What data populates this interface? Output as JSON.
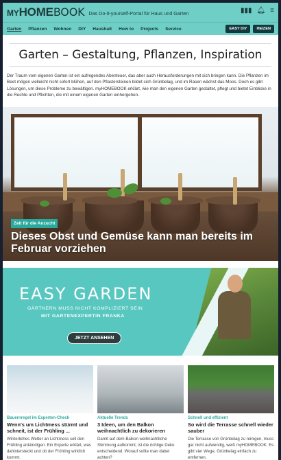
{
  "header": {
    "logo_my": "MY",
    "logo_home": "HOME",
    "logo_book": "BOOK",
    "tagline": "Das Do-it-yourself-Portal für Haus und Garten",
    "icons": [
      "menu-bars-icon",
      "bell-icon",
      "hamburger-icon"
    ]
  },
  "nav": {
    "items": [
      "Garten",
      "Pflanzen",
      "Wohnen",
      "DIY",
      "Haushalt",
      "How to",
      "Projects",
      "Service"
    ],
    "active": "Garten",
    "btn_easy": "EASY DIY",
    "btn_heizen": "HEIZEN"
  },
  "page": {
    "title": "Garten – Gestaltung, Pflanzen, Inspiration",
    "intro": "Der Traum vom eigenen Garten ist ein aufregendes Abenteuer, das aber auch Herausforderungen mit sich bringen kann. Die Pflanzen im Beet mögen vielleicht nicht sofort blühen, auf den Pflastersteinen bildet sich Grünbelag, und im Rasen wächst das Moos. Doch es gibt Lösungen, um diese Probleme zu bewältigen. myHOMEBOOK erklärt, wie man den eigenen Garten gestaltet, pflegt und bietet Einblicke in die Rechte und Pflichten, die mit einem eigenen Garten einhergehen."
  },
  "hero": {
    "tag": "Zeit für die Anzucht",
    "headline": "Dieses Obst und Gemüse kann man bereits im Februar vorziehen"
  },
  "banner": {
    "title": "EASY GARDEN",
    "subtitle1": "GÄRTNERN MUSS NICHT KOMPLIZIERT SEIN",
    "subtitle2": "MIT GARTENEXPERTIN FRANKA",
    "button": "JETZT ANSEHEN"
  },
  "cards": [
    {
      "kicker": "Bauernregel im Experten-Check",
      "title": "Wenn's um Lichtmess stürmt und schneit, ist der Frühling ...",
      "text": "Winterliches Wetter an Lichtmess soll den Frühling ankündigen. Ein Experte erklärt, was dahintersteckt und ob der Frühling wirklich kommt."
    },
    {
      "kicker": "Aktuelle Trends",
      "title": "3 Ideen, um den Balkon weihnachtlich zu dekorieren",
      "text": "Damit auf dem Balkon weihnachtliche Stimmung aufkommt, ist die richtige Deko entscheidend. Worauf sollte man dabei achten?"
    },
    {
      "kicker": "Schnell und effizient",
      "title": "So wird die Terrasse schnell wieder sauber",
      "text": "Die Terrasse von Grünbelag zu reinigen, muss gar nicht aufwendig, weiß myHOMEBOOK. Es gibt vier Wege, Grünbelag einfach zu entfernen."
    }
  ]
}
